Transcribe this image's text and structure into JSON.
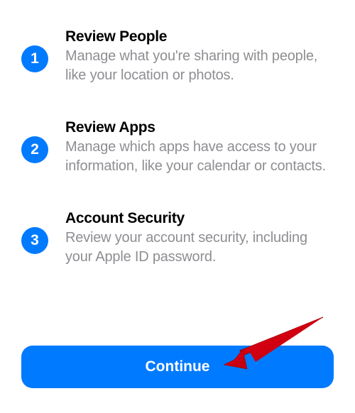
{
  "steps": [
    {
      "number": "1",
      "title": "Review People",
      "description": "Manage what you're sharing with people, like your location or photos."
    },
    {
      "number": "2",
      "title": "Review Apps",
      "description": "Manage which apps have access to your information, like your calendar or contacts."
    },
    {
      "number": "3",
      "title": "Account Security",
      "description": "Review your account security, including your Apple ID password."
    }
  ],
  "continue_label": "Continue",
  "colors": {
    "accent": "#007AFF",
    "text_primary": "#000000",
    "text_secondary": "#8E8E93",
    "annotation_red": "#D90012"
  }
}
